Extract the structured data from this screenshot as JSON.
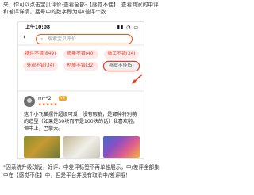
{
  "instruction_text": "来，你可以点击宝贝评价-查看全部-【感觉不佳】，查看商家的中评和差评详情，括号中的数字即为中/差评个数",
  "status_bar": {
    "time": "上午10:08",
    "icons": "▮▮ ◔ ▭"
  },
  "search": {
    "placeholder": "搜索宝贝评价"
  },
  "tags": [
    {
      "label": "摆件不错(849)"
    },
    {
      "label": "质量不错(40)"
    },
    {
      "label": "做工不错(34)"
    },
    {
      "label": "外观不错(34)"
    },
    {
      "label": "材质不错(32)"
    },
    {
      "label": "感觉不佳(5)"
    }
  ],
  "review": {
    "username": "m**2",
    "badge": "VIP",
    "rating": "★★★★★",
    "text": "这个小飞猫摆件超级可爱，没有瑕疵，是那种特别萌的造型（如果是30块而不是100块的话）我喜欢啦，但中上，巴掌大。"
  },
  "note": "*因系统升级改版，好评、中差评标签不再单独展示，中/差评全部集中在【感觉不佳】中，但是平台并没有取消中/差评哦！",
  "colors": {
    "accent": "#ff5000",
    "tag_red": "#e23d2e",
    "tag_bg": "#fde9e7"
  }
}
